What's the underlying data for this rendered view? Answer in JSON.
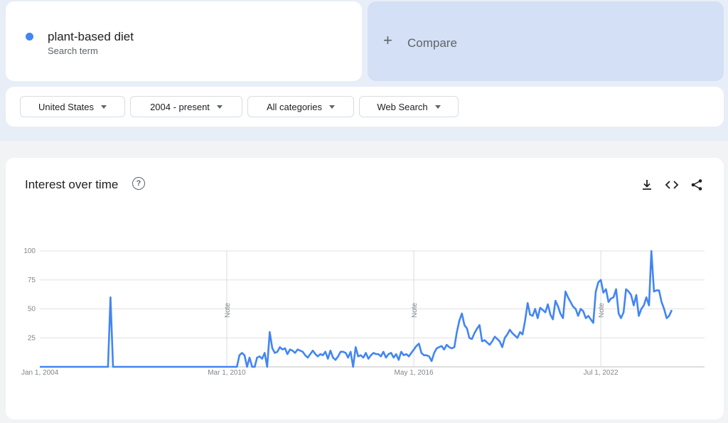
{
  "search_term": {
    "name": "plant-based diet",
    "subtitle": "Search term",
    "color": "#4285f4"
  },
  "compare": {
    "label": "Compare",
    "icon": "plus-icon"
  },
  "filters": {
    "region": "United States",
    "time_range": "2004 - present",
    "category": "All categories",
    "search_type": "Web Search"
  },
  "card": {
    "title": "Interest over time",
    "help_icon": "help-circle-icon",
    "tools": [
      "download-icon",
      "embed-code-icon",
      "share-icon"
    ]
  },
  "chart_data": {
    "type": "line",
    "title": "",
    "xlabel": "",
    "ylabel": "",
    "ylim": [
      0,
      100
    ],
    "yticks": [
      25,
      50,
      75,
      100
    ],
    "x_tick_labels": [
      {
        "date": "2004-01-01",
        "label": "Jan 1, 2004"
      },
      {
        "date": "2010-03-01",
        "label": "Mar 1, 2010"
      },
      {
        "date": "2016-05-01",
        "label": "May 1, 2016"
      },
      {
        "date": "2022-07-01",
        "label": "Jul 1, 2022"
      }
    ],
    "notes": [
      {
        "date": "2010-03-01",
        "label": "Note"
      },
      {
        "date": "2016-05-01",
        "label": "Note"
      },
      {
        "date": "2022-07-01",
        "label": "Note"
      }
    ],
    "x_end": "2025-12-01",
    "series": [
      {
        "color": "#4285f4",
        "points": [
          [
            "2004-01-01",
            0
          ],
          [
            "2006-04-01",
            0
          ],
          [
            "2006-05-01",
            60
          ],
          [
            "2006-06-01",
            0
          ],
          [
            "2010-03-01",
            0
          ],
          [
            "2010-07-01",
            0
          ],
          [
            "2010-08-01",
            10
          ],
          [
            "2010-09-01",
            12
          ],
          [
            "2010-10-01",
            10
          ],
          [
            "2010-11-01",
            0
          ],
          [
            "2010-12-01",
            8
          ],
          [
            "2011-01-01",
            0
          ],
          [
            "2011-02-01",
            0
          ],
          [
            "2011-03-01",
            8
          ],
          [
            "2011-04-01",
            9
          ],
          [
            "2011-05-01",
            7
          ],
          [
            "2011-06-01",
            12
          ],
          [
            "2011-07-01",
            0
          ],
          [
            "2011-08-01",
            30
          ],
          [
            "2011-09-01",
            16
          ],
          [
            "2011-10-01",
            12
          ],
          [
            "2011-11-01",
            13
          ],
          [
            "2011-12-01",
            17
          ],
          [
            "2012-01-01",
            15
          ],
          [
            "2012-02-01",
            16
          ],
          [
            "2012-03-01",
            11
          ],
          [
            "2012-04-01",
            15
          ],
          [
            "2012-05-01",
            14
          ],
          [
            "2012-06-01",
            12
          ],
          [
            "2012-07-01",
            15
          ],
          [
            "2012-08-01",
            14
          ],
          [
            "2012-09-01",
            13
          ],
          [
            "2012-10-01",
            10
          ],
          [
            "2012-11-01",
            8
          ],
          [
            "2012-12-01",
            11
          ],
          [
            "2013-01-01",
            14
          ],
          [
            "2013-02-01",
            11
          ],
          [
            "2013-03-01",
            9
          ],
          [
            "2013-04-01",
            11
          ],
          [
            "2013-05-01",
            10
          ],
          [
            "2013-06-01",
            13
          ],
          [
            "2013-07-01",
            7
          ],
          [
            "2013-08-01",
            14
          ],
          [
            "2013-09-01",
            8
          ],
          [
            "2013-10-01",
            6
          ],
          [
            "2013-11-01",
            9
          ],
          [
            "2013-12-01",
            13
          ],
          [
            "2014-01-01",
            13
          ],
          [
            "2014-02-01",
            12
          ],
          [
            "2014-03-01",
            8
          ],
          [
            "2014-04-01",
            13
          ],
          [
            "2014-05-01",
            0
          ],
          [
            "2014-06-01",
            17
          ],
          [
            "2014-07-01",
            9
          ],
          [
            "2014-08-01",
            10
          ],
          [
            "2014-09-01",
            8
          ],
          [
            "2014-10-01",
            12
          ],
          [
            "2014-11-01",
            7
          ],
          [
            "2014-12-01",
            10
          ],
          [
            "2015-01-01",
            12
          ],
          [
            "2015-02-01",
            11
          ],
          [
            "2015-03-01",
            11
          ],
          [
            "2015-04-01",
            9
          ],
          [
            "2015-05-01",
            13
          ],
          [
            "2015-06-01",
            8
          ],
          [
            "2015-07-01",
            11
          ],
          [
            "2015-08-01",
            12
          ],
          [
            "2015-09-01",
            8
          ],
          [
            "2015-10-01",
            11
          ],
          [
            "2015-11-01",
            6
          ],
          [
            "2015-12-01",
            13
          ],
          [
            "2016-01-01",
            10
          ],
          [
            "2016-02-01",
            11
          ],
          [
            "2016-03-01",
            9
          ],
          [
            "2016-04-01",
            12
          ],
          [
            "2016-05-01",
            15
          ],
          [
            "2016-06-01",
            18
          ],
          [
            "2016-07-01",
            20
          ],
          [
            "2016-08-01",
            12
          ],
          [
            "2016-09-01",
            10
          ],
          [
            "2016-10-01",
            10
          ],
          [
            "2016-11-01",
            9
          ],
          [
            "2016-12-01",
            5
          ],
          [
            "2017-01-01",
            12
          ],
          [
            "2017-02-01",
            16
          ],
          [
            "2017-03-01",
            17
          ],
          [
            "2017-04-01",
            18
          ],
          [
            "2017-05-01",
            15
          ],
          [
            "2017-06-01",
            19
          ],
          [
            "2017-07-01",
            17
          ],
          [
            "2017-08-01",
            16
          ],
          [
            "2017-09-01",
            17
          ],
          [
            "2017-10-01",
            30
          ],
          [
            "2017-11-01",
            40
          ],
          [
            "2017-12-01",
            46
          ],
          [
            "2018-01-01",
            36
          ],
          [
            "2018-02-01",
            33
          ],
          [
            "2018-03-01",
            25
          ],
          [
            "2018-04-01",
            24
          ],
          [
            "2018-05-01",
            29
          ],
          [
            "2018-06-01",
            33
          ],
          [
            "2018-07-01",
            36
          ],
          [
            "2018-08-01",
            22
          ],
          [
            "2018-09-01",
            23
          ],
          [
            "2018-10-01",
            21
          ],
          [
            "2018-11-01",
            19
          ],
          [
            "2018-12-01",
            22
          ],
          [
            "2019-01-01",
            26
          ],
          [
            "2019-02-01",
            24
          ],
          [
            "2019-03-01",
            22
          ],
          [
            "2019-04-01",
            17
          ],
          [
            "2019-05-01",
            25
          ],
          [
            "2019-06-01",
            28
          ],
          [
            "2019-07-01",
            32
          ],
          [
            "2019-08-01",
            29
          ],
          [
            "2019-09-01",
            27
          ],
          [
            "2019-10-01",
            25
          ],
          [
            "2019-11-01",
            30
          ],
          [
            "2019-12-01",
            28
          ],
          [
            "2020-01-01",
            40
          ],
          [
            "2020-02-01",
            55
          ],
          [
            "2020-03-01",
            45
          ],
          [
            "2020-04-01",
            44
          ],
          [
            "2020-05-01",
            50
          ],
          [
            "2020-06-01",
            42
          ],
          [
            "2020-07-01",
            51
          ],
          [
            "2020-08-01",
            49
          ],
          [
            "2020-09-01",
            47
          ],
          [
            "2020-10-01",
            54
          ],
          [
            "2020-11-01",
            45
          ],
          [
            "2020-12-01",
            41
          ],
          [
            "2021-01-01",
            57
          ],
          [
            "2021-02-01",
            52
          ],
          [
            "2021-03-01",
            46
          ],
          [
            "2021-04-01",
            42
          ],
          [
            "2021-05-01",
            65
          ],
          [
            "2021-06-01",
            60
          ],
          [
            "2021-07-01",
            56
          ],
          [
            "2021-08-01",
            52
          ],
          [
            "2021-09-01",
            50
          ],
          [
            "2021-10-01",
            44
          ],
          [
            "2021-11-01",
            50
          ],
          [
            "2021-12-01",
            48
          ],
          [
            "2022-01-01",
            42
          ],
          [
            "2022-02-01",
            44
          ],
          [
            "2022-03-01",
            41
          ],
          [
            "2022-04-01",
            38
          ],
          [
            "2022-05-01",
            65
          ],
          [
            "2022-06-01",
            73
          ],
          [
            "2022-07-01",
            75
          ],
          [
            "2022-08-01",
            64
          ],
          [
            "2022-09-01",
            67
          ],
          [
            "2022-10-01",
            56
          ],
          [
            "2022-11-01",
            59
          ],
          [
            "2022-12-01",
            60
          ],
          [
            "2023-01-01",
            67
          ],
          [
            "2023-02-01",
            46
          ],
          [
            "2023-03-01",
            42
          ],
          [
            "2023-04-01",
            47
          ],
          [
            "2023-05-01",
            67
          ],
          [
            "2023-06-01",
            65
          ],
          [
            "2023-07-01",
            62
          ],
          [
            "2023-08-01",
            53
          ],
          [
            "2023-09-01",
            62
          ],
          [
            "2023-10-01",
            44
          ],
          [
            "2023-11-01",
            50
          ],
          [
            "2023-12-01",
            53
          ],
          [
            "2024-01-01",
            60
          ],
          [
            "2024-02-01",
            53
          ],
          [
            "2024-03-01",
            100
          ],
          [
            "2024-04-01",
            65
          ],
          [
            "2024-05-01",
            66
          ],
          [
            "2024-06-01",
            66
          ],
          [
            "2024-07-01",
            56
          ],
          [
            "2024-08-01",
            50
          ],
          [
            "2024-09-01",
            42
          ],
          [
            "2024-10-01",
            44
          ],
          [
            "2024-11-01",
            49
          ]
        ]
      }
    ]
  }
}
